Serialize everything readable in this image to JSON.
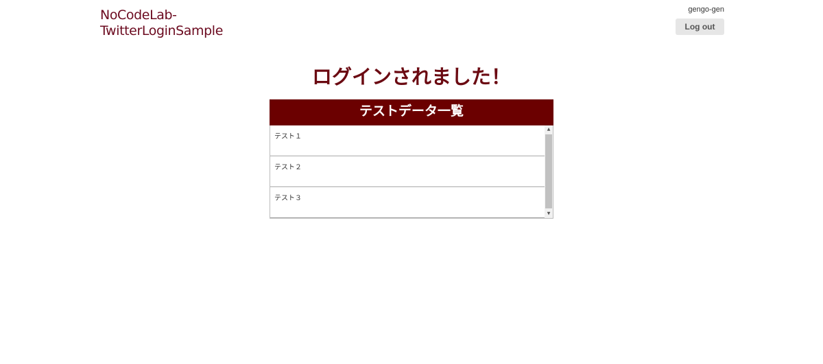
{
  "header": {
    "app_title_line1": "NoCodeLab-",
    "app_title_line2": "TwitterLoginSample",
    "username": "gengo-gen",
    "logout_label": "Log out"
  },
  "main": {
    "title": "ログインされました！",
    "panel_title": "テストデータ一覧",
    "items": [
      {
        "label": "テスト１"
      },
      {
        "label": "テスト２"
      },
      {
        "label": "テスト３"
      }
    ]
  },
  "colors": {
    "accent": "#6b0000",
    "title_text": "#6b0a12",
    "brand_text": "#6b0a1f",
    "button_bg": "#e6e6e6"
  },
  "icons": {
    "scroll_up": "scroll-up-arrow-icon",
    "scroll_down": "scroll-down-arrow-icon"
  }
}
